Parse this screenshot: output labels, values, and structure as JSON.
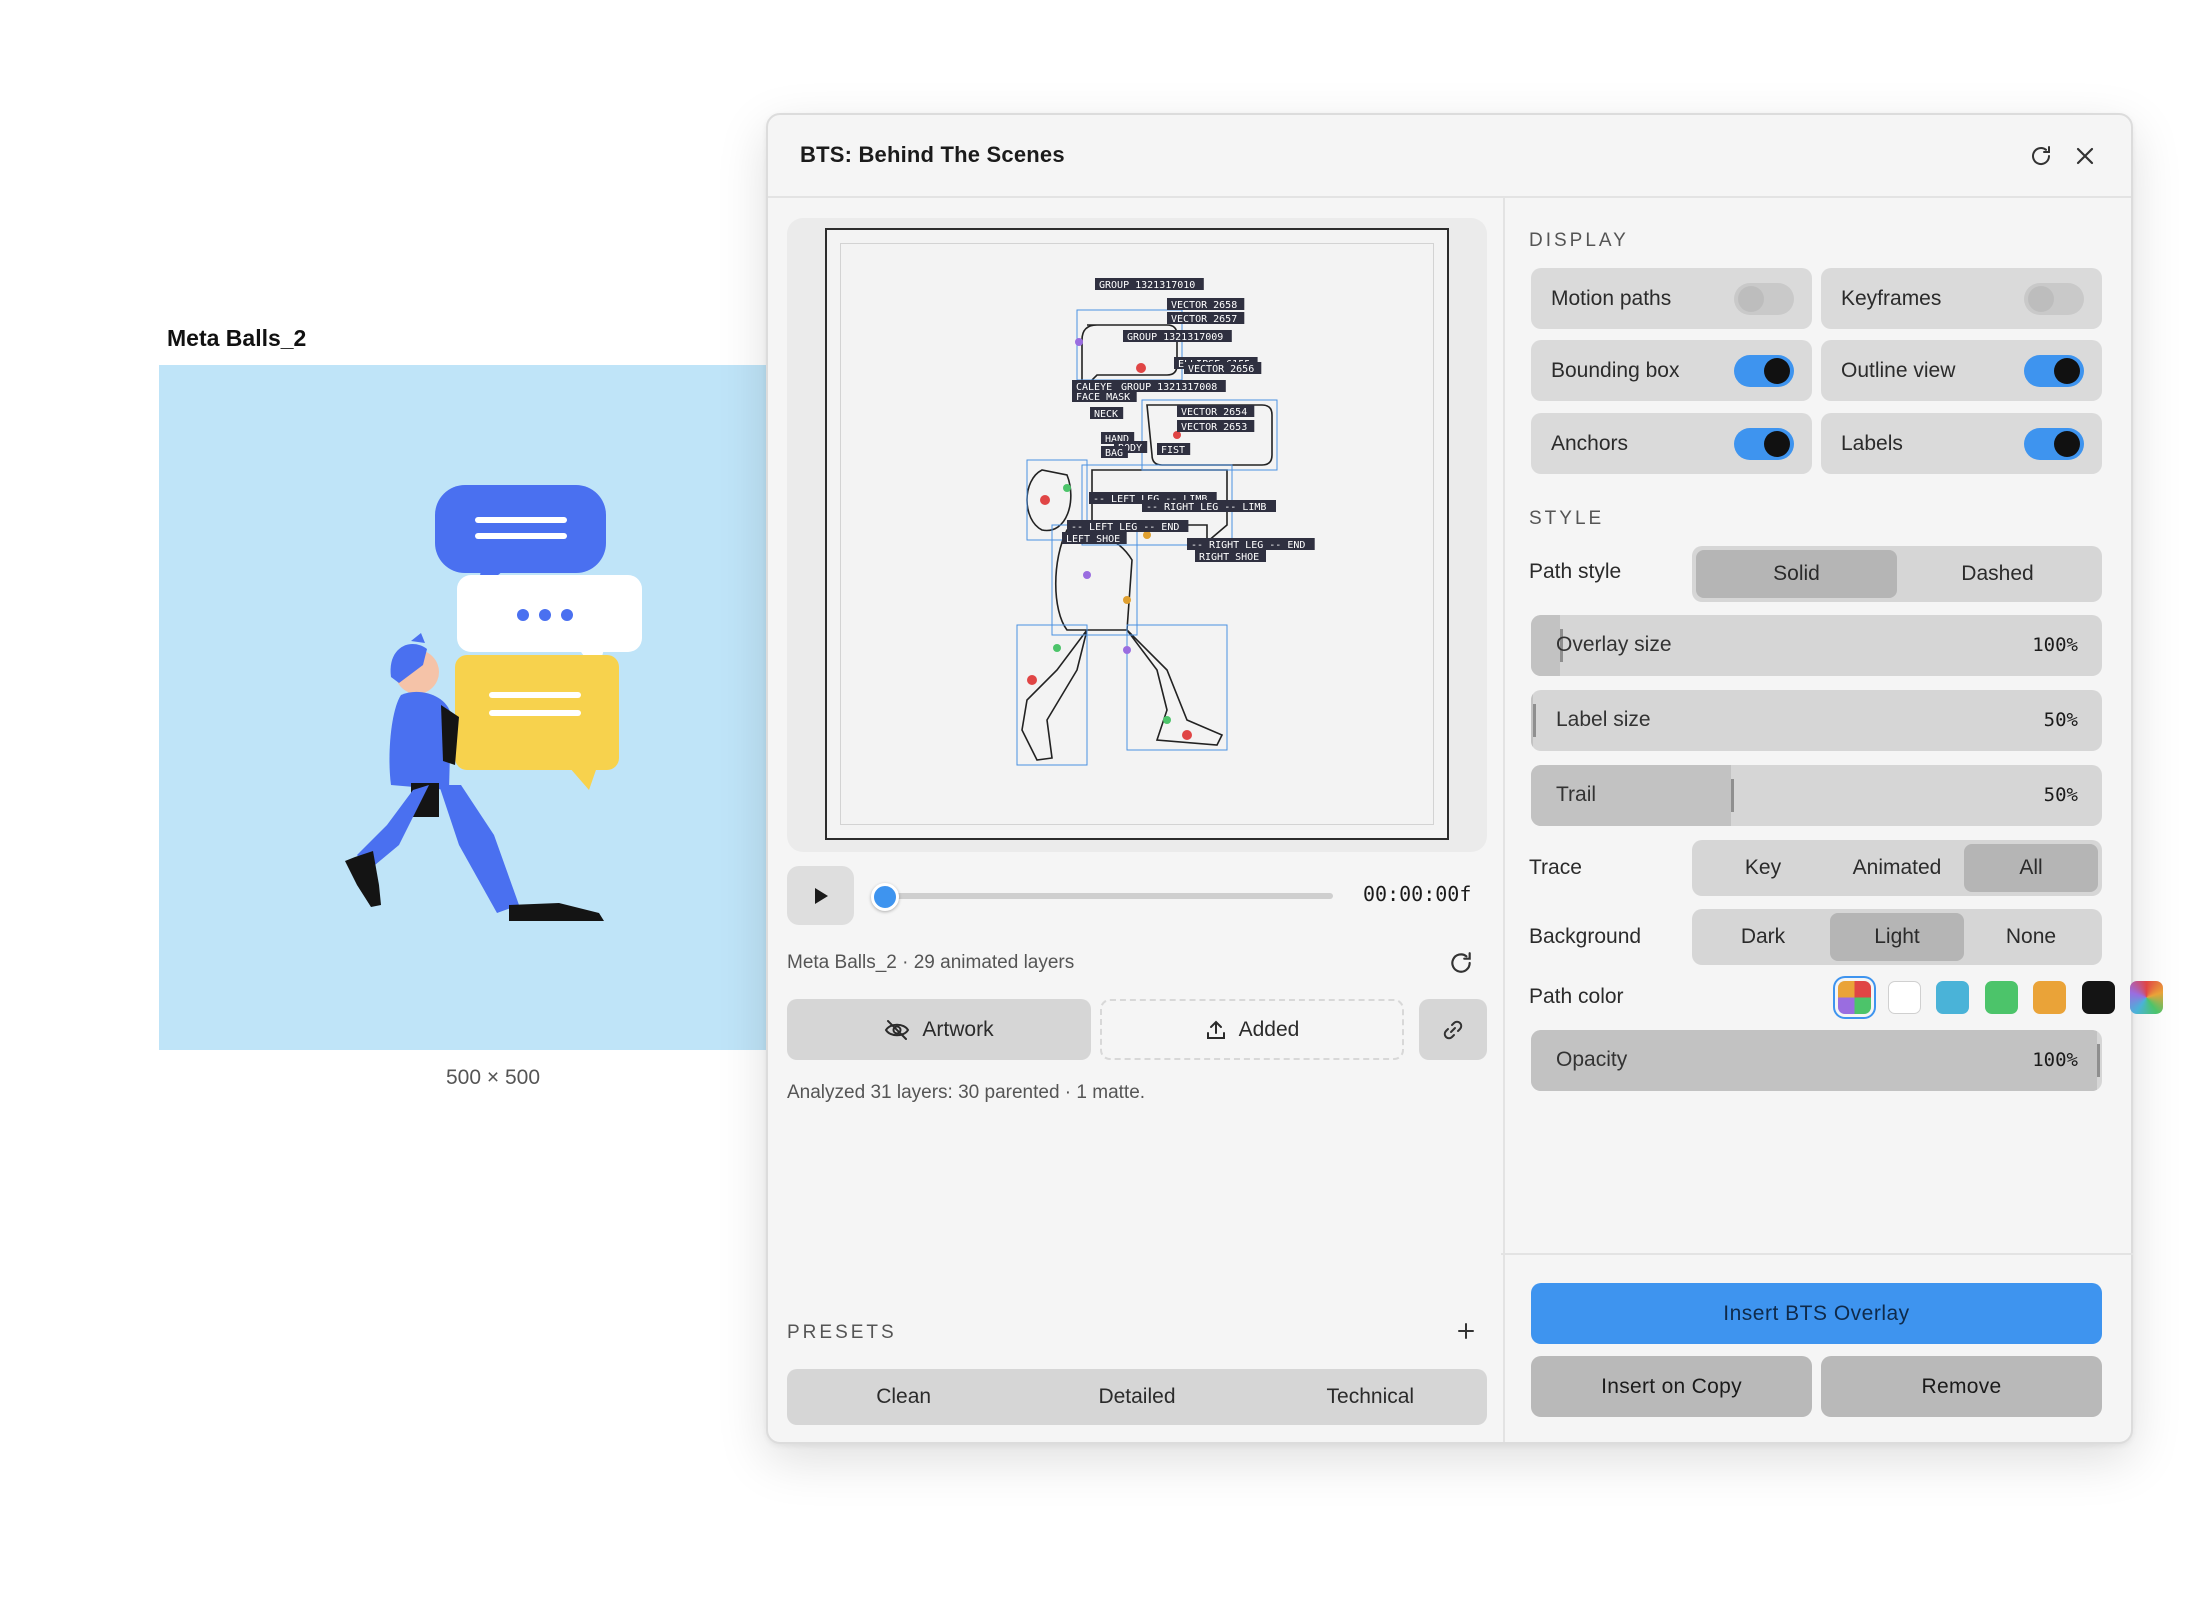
{
  "canvas": {
    "frame_title": "Meta Balls_2",
    "frame_dims": "500 × 500",
    "background_color": "#bfe4f8"
  },
  "panel": {
    "title": "BTS: Behind The Scenes",
    "refresh_icon": "refresh-icon",
    "close_icon": "close-icon"
  },
  "preview": {
    "overlay_labels": [
      "GROUP 1321317010",
      "VECTOR 2658",
      "VECTOR 2657",
      "GROUP 1321317009",
      "ELLIPSE 6155",
      "VECTOR 2656",
      "GROUP 1321317008",
      "CALEYE",
      "FACE MASK",
      "NECK",
      "VECTOR 2654",
      "VECTOR 2653",
      "HAND",
      "BODY",
      "BAG",
      "FIST",
      "-- LEFT LEG -- LIMB",
      "-- RIGHT LEG -- LIMB",
      "-- LEFT LEG -- END",
      "LEFT SHOE",
      "-- RIGHT LEG -- END",
      "RIGHT SHOE"
    ]
  },
  "transport": {
    "timecode": "00:00:00f",
    "progress": 0
  },
  "info": {
    "layers": "Meta Balls_2 · 29 animated layers",
    "analyzed": "Analyzed 31 layers: 30 parented · 1 matte."
  },
  "actions": {
    "artwork": "Artwork",
    "added": "Added"
  },
  "presets": {
    "label": "PRESETS",
    "items": [
      "Clean",
      "Detailed",
      "Technical"
    ]
  },
  "display": {
    "label": "DISPLAY",
    "toggles": [
      {
        "label": "Motion paths",
        "on": false
      },
      {
        "label": "Keyframes",
        "on": false
      },
      {
        "label": "Bounding box",
        "on": true
      },
      {
        "label": "Outline view",
        "on": true
      },
      {
        "label": "Anchors",
        "on": true
      },
      {
        "label": "Labels",
        "on": true
      }
    ]
  },
  "style": {
    "label": "STYLE",
    "path_style": {
      "label": "Path style",
      "options": [
        "Solid",
        "Dashed"
      ],
      "selected": "Solid"
    },
    "overlay_size": {
      "label": "Overlay size",
      "value": "100%",
      "fraction": 0.05
    },
    "label_size": {
      "label": "Label size",
      "value": "50%",
      "fraction": 0.0
    },
    "trail": {
      "label": "Trail",
      "value": "50%",
      "fraction": 0.35
    },
    "trace": {
      "label": "Trace",
      "options": [
        "Key",
        "Animated",
        "All"
      ],
      "selected": "All"
    },
    "background": {
      "label": "Background",
      "options": [
        "Dark",
        "Light",
        "None"
      ],
      "selected": "Light"
    },
    "path_color": {
      "label": "Path color",
      "swatches": [
        "multicolor",
        "#ffffff",
        "#4ab3d8",
        "#4cc46a",
        "#eaa338",
        "#141414",
        "rainbow"
      ],
      "selected": 0
    },
    "opacity": {
      "label": "Opacity",
      "value": "100%",
      "fraction": 1.0
    }
  },
  "footer": {
    "insert": "Insert BTS Overlay",
    "insert_copy": "Insert on Copy",
    "remove": "Remove"
  },
  "colors": {
    "accent": "#3e94ef",
    "panel_bg": "#f5f5f5",
    "control_bg": "#d6d6d6",
    "character_blue": "#4a70f0",
    "bubble_yellow": "#f7d24d"
  }
}
